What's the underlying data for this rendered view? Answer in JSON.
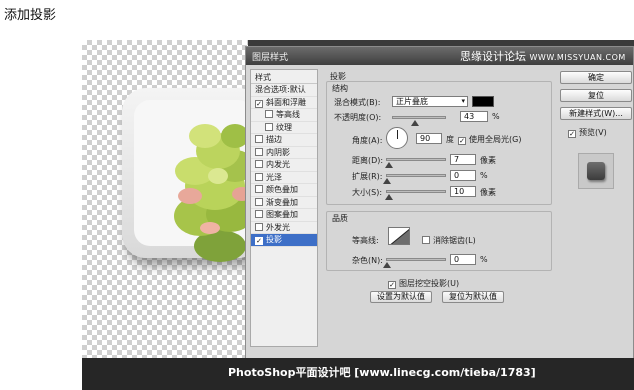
{
  "heading": "添加投影",
  "watermark_top": {
    "text": "思缘设计论坛",
    "url": "WWW.MISSYUAN.COM"
  },
  "watermark_bottom": "PhotoShop平面设计吧 [www.linecg.com/tieba/1783]",
  "dialog": {
    "title": "图层样式",
    "styles_header": "样式",
    "styles": [
      {
        "label": "混合选项:默认",
        "checkbox": false,
        "checked": false,
        "active": false,
        "sub": false
      },
      {
        "label": "斜面和浮雕",
        "checkbox": true,
        "checked": true,
        "active": false,
        "sub": false
      },
      {
        "label": "等高线",
        "checkbox": true,
        "checked": false,
        "active": false,
        "sub": true
      },
      {
        "label": "纹理",
        "checkbox": true,
        "checked": false,
        "active": false,
        "sub": true
      },
      {
        "label": "描边",
        "checkbox": true,
        "checked": false,
        "active": false,
        "sub": false
      },
      {
        "label": "内阴影",
        "checkbox": true,
        "checked": false,
        "active": false,
        "sub": false
      },
      {
        "label": "内发光",
        "checkbox": true,
        "checked": false,
        "active": false,
        "sub": false
      },
      {
        "label": "光泽",
        "checkbox": true,
        "checked": false,
        "active": false,
        "sub": false
      },
      {
        "label": "颜色叠加",
        "checkbox": true,
        "checked": false,
        "active": false,
        "sub": false
      },
      {
        "label": "渐变叠加",
        "checkbox": true,
        "checked": false,
        "active": false,
        "sub": false
      },
      {
        "label": "图案叠加",
        "checkbox": true,
        "checked": false,
        "active": false,
        "sub": false
      },
      {
        "label": "外发光",
        "checkbox": true,
        "checked": false,
        "active": false,
        "sub": false
      },
      {
        "label": "投影",
        "checkbox": true,
        "checked": true,
        "active": true,
        "sub": false
      }
    ],
    "drop_shadow": {
      "title": "投影",
      "structure_title": "结构",
      "blend_mode_label": "混合模式(B):",
      "blend_mode_value": "正片叠底",
      "shadow_color": "#000000",
      "opacity_label": "不透明度(O):",
      "opacity_value": "43",
      "opacity_level": 0.43,
      "unit_percent": "%",
      "angle_label": "角度(A):",
      "angle_value": "90",
      "angle_unit": "度",
      "global_light_label": "使用全局光(G)",
      "global_light_checked": true,
      "distance_label": "距离(D):",
      "distance_value": "7",
      "size_unit": "像素",
      "spread_label": "扩展(R):",
      "spread_value": "0",
      "size_label": "大小(S):",
      "size_value": "10",
      "quality_title": "品质",
      "contour_label": "等高线:",
      "antialias_label": "消除锯齿(L)",
      "antialias_checked": false,
      "noise_label": "杂色(N):",
      "noise_value": "0",
      "knockout_label": "图层挖空投影(U)",
      "knockout_checked": true,
      "make_default": "设置为默认值",
      "reset_default": "复位为默认值"
    },
    "buttons": {
      "ok": "确定",
      "reset": "复位",
      "new_style": "新建样式(W)...",
      "preview_label": "预览(V)",
      "preview_checked": true
    }
  }
}
